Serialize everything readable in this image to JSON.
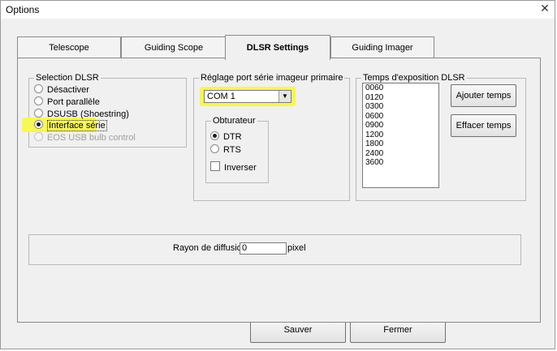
{
  "window": {
    "title": "Options",
    "close_glyph": "✕"
  },
  "tabs": [
    {
      "label": "Telescope",
      "active": false
    },
    {
      "label": "Guiding Scope",
      "active": false
    },
    {
      "label": "DLSR Settings",
      "active": true
    },
    {
      "label": "Guiding Imager",
      "active": false
    }
  ],
  "selection_dlsr": {
    "legend": "Selection DLSR",
    "options": [
      {
        "label": "Désactiver",
        "selected": false,
        "enabled": true
      },
      {
        "label": "Port parallèle",
        "selected": false,
        "enabled": true
      },
      {
        "label": "DSUSB (Shoestring)",
        "selected": false,
        "enabled": true
      },
      {
        "label": "Interface série",
        "selected": true,
        "enabled": true
      },
      {
        "label": "EOS USB bulb control",
        "selected": false,
        "enabled": false
      }
    ]
  },
  "serial_port": {
    "legend": "Réglage port série imageur primaire",
    "combo_value": "COM 1",
    "shutter": {
      "legend": "Obturateur",
      "options": [
        {
          "label": "DTR",
          "selected": true
        },
        {
          "label": "RTS",
          "selected": false
        }
      ],
      "invert_label": "Inverser",
      "invert_checked": false
    }
  },
  "exposure": {
    "legend": "Temps d'exposition DLSR",
    "times": [
      "0060",
      "0120",
      "0300",
      "0600",
      "0900",
      "1200",
      "1800",
      "2400",
      "3600"
    ],
    "add_button": "Ajouter temps",
    "clear_button": "Effacer temps"
  },
  "diffusion": {
    "label": "Rayon de diffusion:",
    "value": "0",
    "unit": "pixel"
  },
  "footer": {
    "save_button": "Sauver",
    "close_button": "Fermer"
  },
  "colors": {
    "highlight": "#f7f757"
  }
}
